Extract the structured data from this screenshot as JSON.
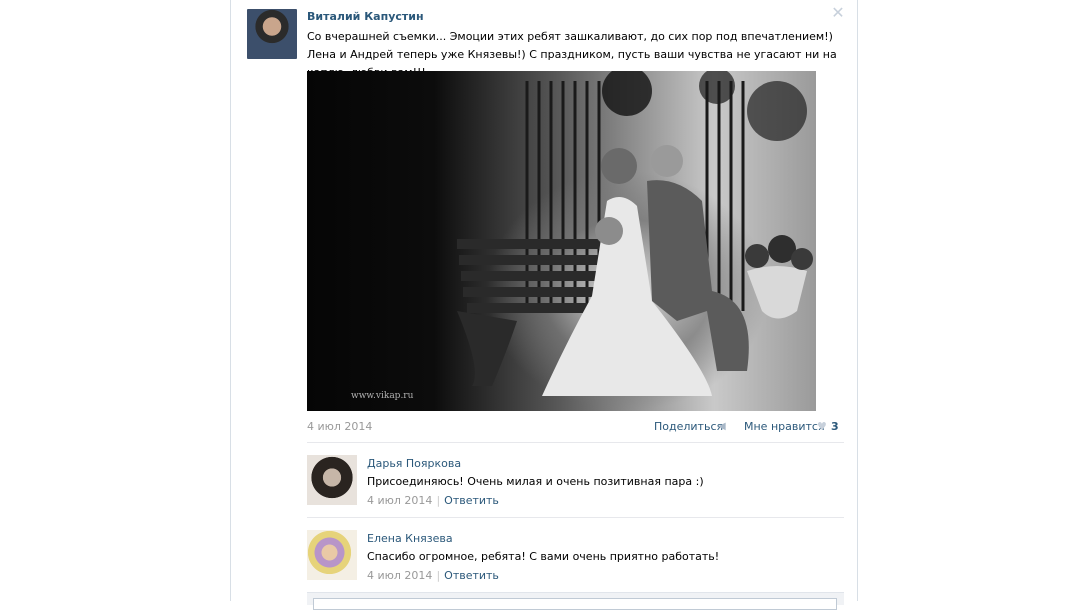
{
  "post": {
    "author_name": "Виталий Капустин",
    "delete_icon": "close-icon",
    "text": "Со вчерашней съемки... Эмоции этих ребят зашкаливают, до сих пор под впечатлением!) Лена и Андрей теперь уже Князевы!) С праздником, пусть ваши чувства не угасают ни на каплю, любви вам!!!",
    "photo_watermark": "www.vikap.ru",
    "date": "4 июл 2014",
    "share_label": "Поделиться",
    "like_label": "Мне нравится",
    "like_count": "3"
  },
  "comments": [
    {
      "name": "Дарья Пояркова",
      "text": "Присоединяюсь! Очень милая и очень позитивная пара :)",
      "date": "4 июл 2014",
      "separator": "|",
      "reply_label": "Ответить"
    },
    {
      "name": "Елена Князева",
      "text": "Спасибо огромное, ребята! С вами очень приятно работать!",
      "date": "4 июл 2014",
      "separator": "|",
      "reply_label": "Ответить"
    }
  ],
  "colors": {
    "link": "#2b587a",
    "muted": "#999999",
    "divider": "#e7e8ec"
  }
}
